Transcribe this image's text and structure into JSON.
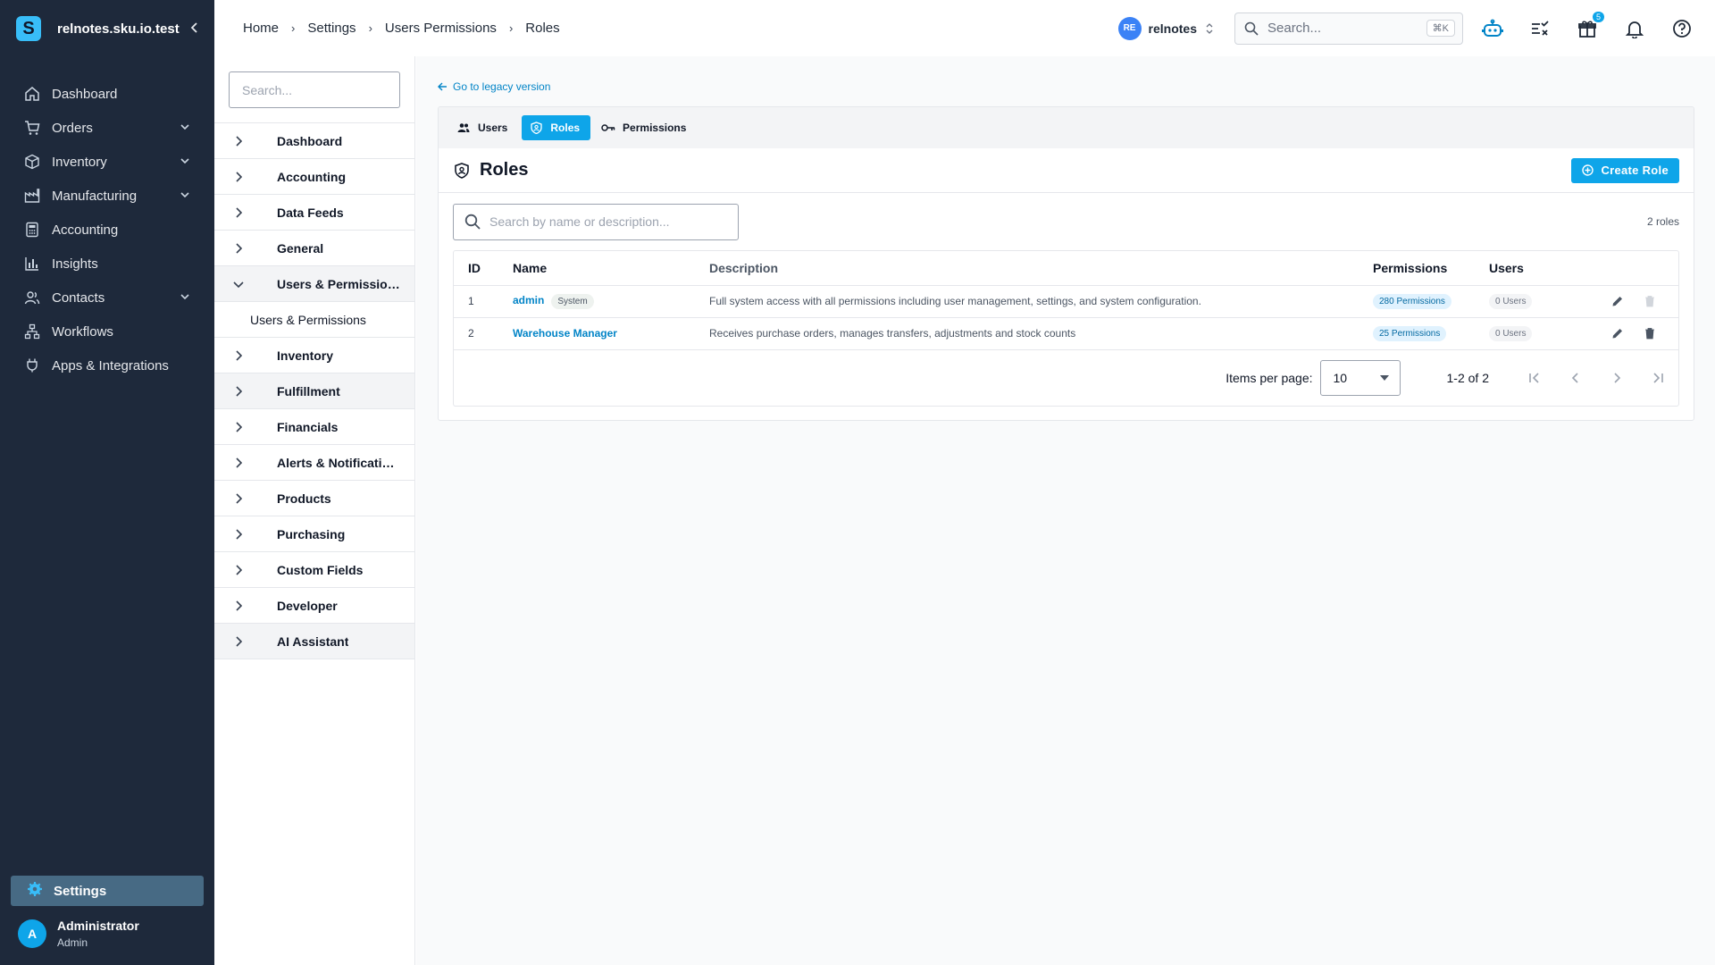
{
  "app": {
    "brand_letter": "S",
    "workspace": "relnotes.sku.io.test",
    "accent": "#0ea5e9"
  },
  "sidebar": {
    "items": [
      {
        "label": "Dashboard",
        "icon": "home-icon",
        "has_chevron": false
      },
      {
        "label": "Orders",
        "icon": "cart-icon",
        "has_chevron": true
      },
      {
        "label": "Inventory",
        "icon": "box-icon",
        "has_chevron": true
      },
      {
        "label": "Manufacturing",
        "icon": "factory-icon",
        "has_chevron": true
      },
      {
        "label": "Accounting",
        "icon": "calculator-icon",
        "has_chevron": false
      },
      {
        "label": "Insights",
        "icon": "bar-chart-icon",
        "has_chevron": false
      },
      {
        "label": "Contacts",
        "icon": "contacts-icon",
        "has_chevron": true
      },
      {
        "label": "Workflows",
        "icon": "workflow-icon",
        "has_chevron": false
      },
      {
        "label": "Apps & Integrations",
        "icon": "plug-icon",
        "has_chevron": false
      }
    ],
    "settings_label": "Settings",
    "user": {
      "initial": "A",
      "name": "Administrator",
      "role": "Admin"
    }
  },
  "header": {
    "breadcrumb": [
      "Home",
      "Settings",
      "Users Permissions",
      "Roles"
    ],
    "account_initials": "RE",
    "account_name": "relnotes",
    "search_placeholder": "Search...",
    "search_shortcut": "⌘K",
    "gift_badge": "5"
  },
  "subnav": {
    "search_placeholder": "Search...",
    "items": [
      {
        "label": "Dashboard",
        "expanded": false
      },
      {
        "label": "Accounting",
        "expanded": false
      },
      {
        "label": "Data Feeds",
        "expanded": false
      },
      {
        "label": "General",
        "expanded": false
      },
      {
        "label": "Users & Permissions",
        "expanded": true,
        "children": [
          "Users & Permissions"
        ]
      },
      {
        "label": "Inventory",
        "expanded": false
      },
      {
        "label": "Fulfillment",
        "expanded": false
      },
      {
        "label": "Financials",
        "expanded": false
      },
      {
        "label": "Alerts & Notifications",
        "expanded": false
      },
      {
        "label": "Products",
        "expanded": false
      },
      {
        "label": "Purchasing",
        "expanded": false
      },
      {
        "label": "Custom Fields",
        "expanded": false
      },
      {
        "label": "Developer",
        "expanded": false
      },
      {
        "label": "AI Assistant",
        "expanded": false
      }
    ]
  },
  "main": {
    "legacy_link": "Go to legacy version",
    "tabs": [
      {
        "label": "Users",
        "icon": "users-icon",
        "active": false
      },
      {
        "label": "Roles",
        "icon": "shield-icon",
        "active": true
      },
      {
        "label": "Permissions",
        "icon": "key-icon",
        "active": false
      }
    ],
    "title": "Roles",
    "create_button": "Create Role",
    "search_placeholder": "Search by name or description...",
    "count_label": "2 roles",
    "table": {
      "columns": [
        "ID",
        "Name",
        "Description",
        "Permissions",
        "Users"
      ],
      "rows": [
        {
          "id": "1",
          "name": "admin",
          "tag": "System",
          "description": "Full system access with all permissions including user management, settings, and system configuration.",
          "permissions": "280 Permissions",
          "users": "0 Users",
          "delete_enabled": false
        },
        {
          "id": "2",
          "name": "Warehouse Manager",
          "tag": "",
          "description": "Receives purchase orders, manages transfers, adjustments and stock counts",
          "permissions": "25 Permissions",
          "users": "0 Users",
          "delete_enabled": true
        }
      ]
    },
    "pager": {
      "items_per_page_label": "Items per page:",
      "items_per_page": "10",
      "range": "1-2 of 2"
    }
  }
}
